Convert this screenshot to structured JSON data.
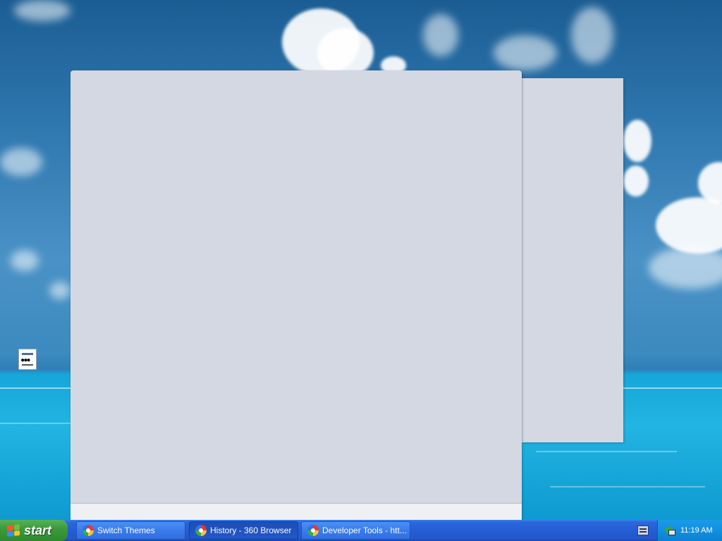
{
  "taskbar": {
    "start_label": "start",
    "tasks": [
      {
        "label": "Switch Themes",
        "icon": "browser-360-icon"
      },
      {
        "label": "History - 360 Browser",
        "icon": "browser-360-icon",
        "active": true
      },
      {
        "label": "Developer Tools - htt...",
        "icon": "browser-360-icon"
      }
    ],
    "tray": {
      "clock": "11:19 AM",
      "language_icon": "keyboard-icon",
      "tray_icon": "network-icon"
    }
  },
  "colors": {
    "taskbar_blue": "#245dd6",
    "start_green": "#3c9a3c",
    "tray_blue": "#1290e0",
    "window_gray": "#d3d8e2"
  }
}
